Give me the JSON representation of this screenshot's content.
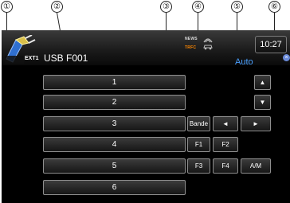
{
  "callouts": [
    "①",
    "②",
    "③",
    "④",
    "⑤",
    "⑥"
  ],
  "header": {
    "source_icon": "ext-plug-icon",
    "source_label": "EXT1",
    "device_name": "USB F001",
    "news_indicator": "NEWS",
    "traffic_indicator": "TRFC",
    "mode": "Auto",
    "clock": "10:27"
  },
  "presets": [
    "1",
    "2",
    "3",
    "4",
    "5",
    "6"
  ],
  "controls": {
    "up": "▲",
    "down": "▼",
    "band": "Bande",
    "left": "◄",
    "right": "►",
    "f1": "F1",
    "f2": "F2",
    "f3": "F3",
    "f4": "F4",
    "am": "A/M",
    "close_badge": "×"
  },
  "colors": {
    "mode_text": "#4aa0ff",
    "traffic_text": "#ff8800",
    "screen_background": "#000000"
  }
}
